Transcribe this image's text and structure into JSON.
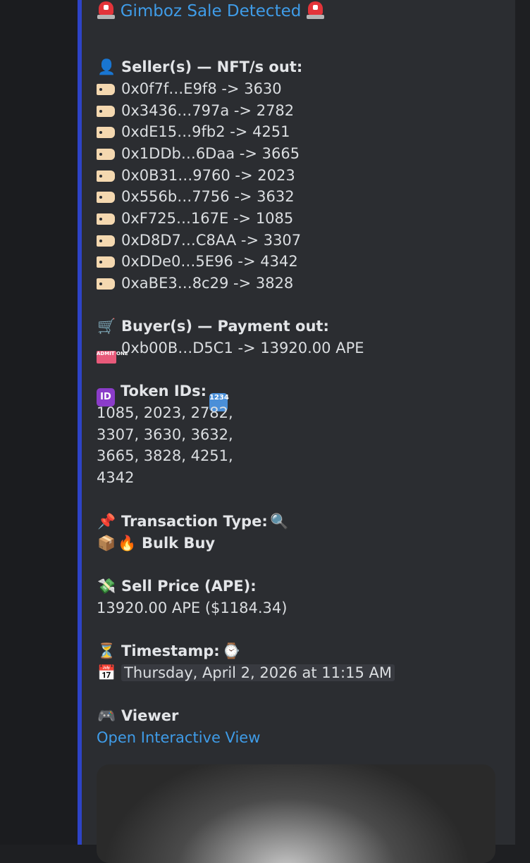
{
  "title": "Gimboz Sale Detected",
  "icons": {
    "siren": "police-siren-icon",
    "seller": "bust-silhouette-icon",
    "tag": "label-tag-icon",
    "cart": "shopping-cart-icon",
    "ticket": "admission-ticket-icon",
    "id": "id-button-icon",
    "numbers": "input-numbers-icon",
    "pin": "pushpin-icon",
    "magnifier": "magnifying-glass-icon",
    "package": "package-icon",
    "fire": "fire-icon",
    "money": "money-with-wings-icon",
    "hourglass": "hourglass-icon",
    "watch": "watch-icon",
    "calendar": "calendar-icon",
    "gamepad": "video-game-controller-icon"
  },
  "ticket_text": "ADMIT ONE",
  "id_badge": "ID",
  "numbers_badge": "1234",
  "calendar_day": "17",
  "sellers": {
    "heading": "Seller(s) — NFT/s out:",
    "items": [
      "0x0f7f…E9f8 -> 3630",
      "0x3436…797a -> 2782",
      "0xdE15…9fb2 -> 4251",
      "0x1DDb…6Daa -> 3665",
      "0x0B31…9760 -> 2023",
      "0x556b…7756 -> 3632",
      "0xF725…167E -> 1085",
      "0xD8D7…C8AA -> 3307",
      "0xDDe0…5E96 -> 4342",
      "0xaBE3…8c29 -> 3828"
    ]
  },
  "buyers": {
    "heading": "Buyer(s) — Payment out:",
    "item": "0xb00B…D5C1 -> 13920.00 APE"
  },
  "token_ids": {
    "heading": "Token IDs:",
    "lines": [
      "1085, 2023, 2782,",
      "3307, 3630, 3632,",
      "3665, 3828, 4251,",
      "4342"
    ]
  },
  "transaction": {
    "heading": "Transaction Type:",
    "value": "Bulk Buy"
  },
  "sell_price": {
    "heading": "Sell Price (APE):",
    "value": "13920.00 APE ($1184.34)"
  },
  "timestamp": {
    "heading": "Timestamp:",
    "value": "Thursday, April 2, 2026 at 11:15 AM"
  },
  "viewer": {
    "heading": "Viewer",
    "link": "Open Interactive View"
  },
  "colors": {
    "accent_bar": "#2d43c7",
    "link": "#3f9ce8",
    "embed_bg": "#2b2d31",
    "page_bg": "#1e1f22"
  }
}
